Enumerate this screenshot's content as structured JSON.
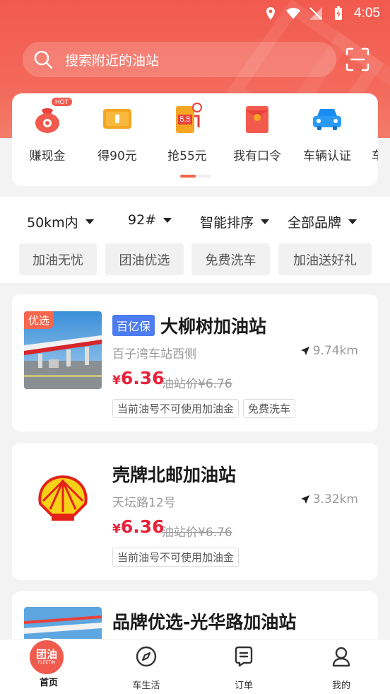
{
  "status_bar": {
    "time": "4:05",
    "icons": [
      "location-icon",
      "wifi-icon",
      "no-signal-icon",
      "battery-charging-icon"
    ]
  },
  "search": {
    "placeholder": "搜索附近的油站",
    "icon": "search-icon",
    "scan_icon": "scan-icon"
  },
  "quick_menu": {
    "items": [
      {
        "label": "赚现金",
        "icon": "money-bag-icon",
        "badge": "HOT"
      },
      {
        "label": "得90元",
        "icon": "ticket-icon"
      },
      {
        "label": "抢55元",
        "icon": "fuel-pump-icon",
        "icon_text": "5.5"
      },
      {
        "label": "我有口令",
        "icon": "red-envelope-icon"
      },
      {
        "label": "车辆认证",
        "icon": "car-icon"
      },
      {
        "label": "车"
      }
    ],
    "page_indicator": {
      "current": 1,
      "total": 2
    }
  },
  "filters": {
    "dropdowns": [
      "50km内",
      "92#",
      "智能排序",
      "全部品牌"
    ],
    "tags": [
      "加油无忧",
      "团油优选",
      "免费洗车",
      "加油送好礼"
    ]
  },
  "stations": [
    {
      "corner_label": "优选",
      "badge": "百亿保",
      "name": "大柳树加油站",
      "address": "百子湾车站西侧",
      "distance": "9.74km",
      "currency": "¥",
      "price": "6.36",
      "original_price": "油站价¥6.76",
      "chips": [
        "当前油号不可使用加油金",
        "免费洗车"
      ]
    },
    {
      "name": "壳牌北邮加油站",
      "address": "天坛路12号",
      "distance": "3.32km",
      "currency": "¥",
      "price": "6.36",
      "original_price": "油站价¥6.76",
      "chips": [
        "当前油号不可使用加油金"
      ]
    },
    {
      "name": "品牌优选-光华路加油站"
    }
  ],
  "tab_bar": {
    "items": [
      {
        "label": "首页",
        "icon": "home-logo-icon",
        "logo_text": "团油",
        "logo_sub": "FLEETIN"
      },
      {
        "label": "车生活",
        "icon": "compass-icon"
      },
      {
        "label": "订单",
        "icon": "order-icon"
      },
      {
        "label": "我的",
        "icon": "profile-icon"
      }
    ]
  },
  "colors": {
    "brand_red": "#f25a4e",
    "price_red": "#e8223a",
    "badge_blue": "#4d7cf0"
  }
}
